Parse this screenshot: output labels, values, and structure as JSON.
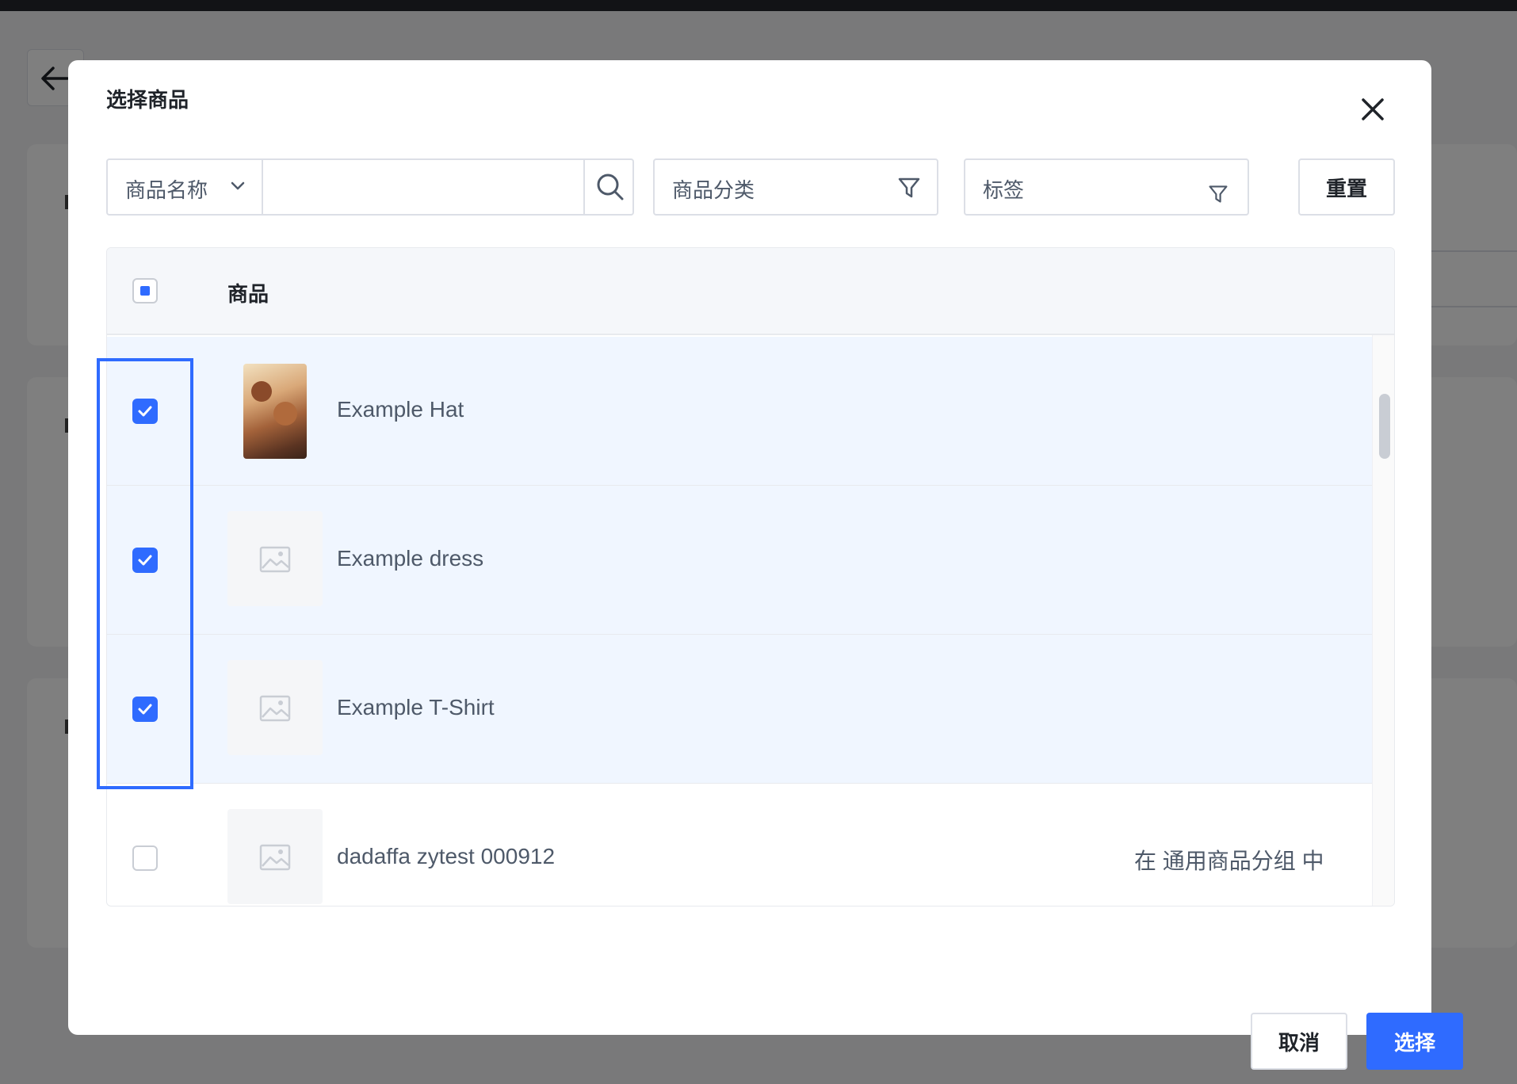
{
  "modal": {
    "title": "选择商品",
    "filters": {
      "field_select_label": "商品名称",
      "search_value": "",
      "category_placeholder": "商品分类",
      "tags_placeholder": "标签",
      "reset_label": "重置"
    },
    "table": {
      "header_label": "商品",
      "header_checkbox_state": "indeterminate",
      "rows": [
        {
          "name": "Example Hat",
          "checked": true,
          "has_image": true,
          "group": ""
        },
        {
          "name": "Example dress",
          "checked": true,
          "has_image": false,
          "group": ""
        },
        {
          "name": "Example T-Shirt",
          "checked": true,
          "has_image": false,
          "group": ""
        },
        {
          "name": "dadaffa zytest 000912",
          "checked": false,
          "has_image": false,
          "group": "在 通用商品分组 中"
        }
      ]
    },
    "footer": {
      "cancel_label": "取消",
      "confirm_label": "选择"
    }
  },
  "colors": {
    "primary": "#2f6bff",
    "selected_row": "#f0f6ff",
    "border": "#dcdfe6",
    "overlay": "rgba(0,0,0,0.5)"
  },
  "icons": [
    "back-arrow-icon",
    "close-icon",
    "chevron-down-icon",
    "search-icon",
    "filter-icon",
    "check-icon",
    "image-placeholder-icon"
  ]
}
